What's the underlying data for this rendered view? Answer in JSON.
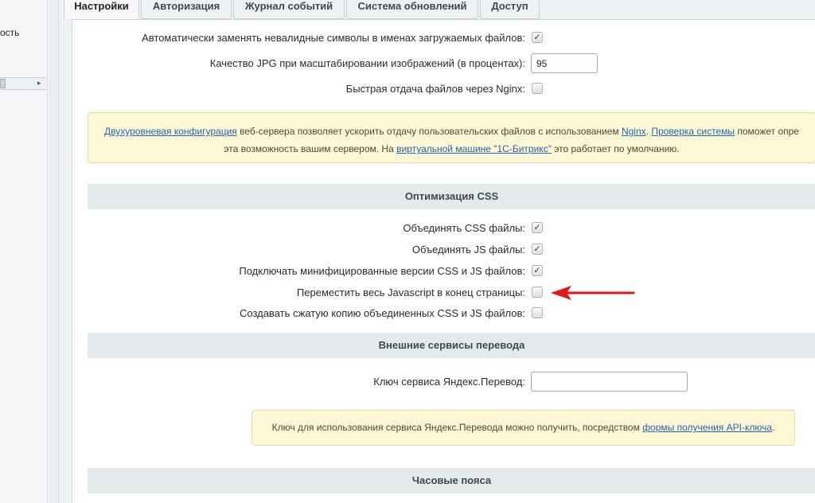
{
  "sidebar": {
    "text": "ость"
  },
  "tabs": [
    {
      "label": "Настройки",
      "active": true
    },
    {
      "label": "Авторизация"
    },
    {
      "label": "Журнал событий"
    },
    {
      "label": "Система обновлений"
    },
    {
      "label": "Доступ"
    }
  ],
  "files": {
    "replace_invalid_label": "Автоматически заменять невалидные символы в именах загружаемых файлов:",
    "replace_invalid_checked": true,
    "jpg_quality_label": "Качество JPG при масштабировании изображений (в процентах):",
    "jpg_quality_value": "95",
    "nginx_fast_label": "Быстрая отдача файлов через Nginx:",
    "nginx_fast_checked": false
  },
  "nginx_notice": {
    "link1": "Двухуровневая конфигурация",
    "text1": " веб-сервера позволяет ускорить отдачу пользовательских файлов с использованием ",
    "link2": "Nginx",
    "text2": ". ",
    "link3": "Проверка системы",
    "text3": " поможет опре",
    "text4": "эта возможность вашим сервером. На ",
    "link4": "виртуальной машине \"1С-Битрикс\"",
    "text5": " это работает по умолчанию."
  },
  "css_section": {
    "title": "Оптимизация CSS",
    "combine_css_label": "Объединять CSS файлы:",
    "combine_css_checked": true,
    "combine_js_label": "Объединять JS файлы:",
    "combine_js_checked": true,
    "minified_label": "Подключать минифицированные версии CSS и JS файлов:",
    "minified_checked": true,
    "move_js_label": "Переместить весь Javascript в конец страницы:",
    "move_js_checked": false,
    "gzip_copy_label": "Создавать сжатую копию объединенных CSS и JS файлов:",
    "gzip_copy_checked": false
  },
  "translate_section": {
    "title": "Внешние сервисы перевода",
    "yandex_key_label": "Ключ сервиса Яндекс.Перевод:",
    "yandex_key_value": "",
    "notice_text": "Ключ для использования сервиса Яндекс.Перевода можно получить, посредством ",
    "notice_link": "формы получения API-ключа",
    "notice_end": "."
  },
  "timezone_section": {
    "title": "Часовые пояса"
  },
  "colors": {
    "accent_link": "#2067b0",
    "notice_bg": "#fdf7d6",
    "section_bg": "#e4e9eb",
    "annotation_arrow": "#e8141b"
  },
  "icons": {
    "checkmark": "✓",
    "arrow_right": "▸"
  }
}
